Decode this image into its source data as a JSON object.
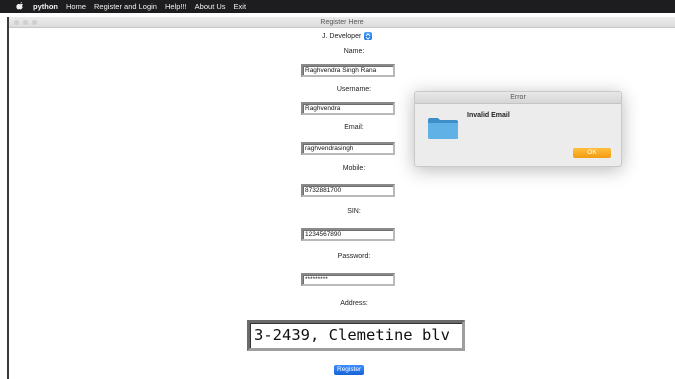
{
  "menubar": {
    "app_name": "python",
    "items": [
      "Home",
      "Register and Login",
      "Help!!!",
      "About Us",
      "Exit"
    ]
  },
  "window": {
    "title": "Register Here"
  },
  "user_menu": {
    "selected": "J. Developer"
  },
  "form": {
    "name_label": "Name:",
    "name_value": "Raghvendra Singh Rana",
    "username_label": "Username:",
    "username_value": "Raghvendra",
    "email_label": "Email:",
    "email_value": "raghvendrasingh",
    "mobile_label": "Mobile:",
    "mobile_value": "8732881700",
    "sin_label": "SIN:",
    "sin_value": "1234567890",
    "password_label": "Password:",
    "password_value": "*********",
    "address_label": "Address:",
    "address_value": "3-2439, Clemetine blv",
    "register_label": "Register"
  },
  "dialog": {
    "title": "Error",
    "message": "Invalid Email",
    "ok_label": "OK",
    "icon": "folder-icon"
  },
  "colors": {
    "accent_blue": "#1a6fe0",
    "ok_orange": "#f39c12",
    "menubar_bg": "#1d1d1f"
  }
}
